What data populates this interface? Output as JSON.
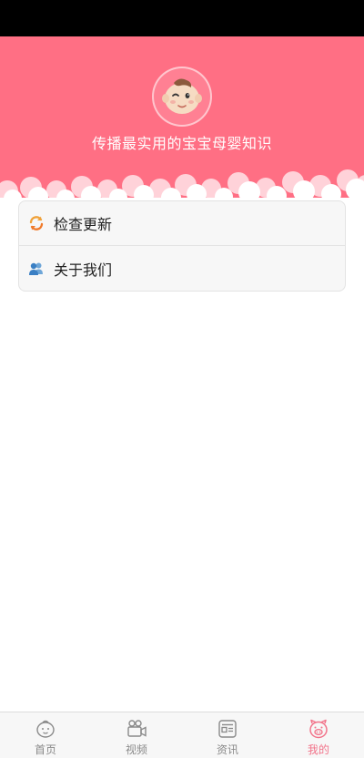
{
  "header": {
    "slogan": "传播最实用的宝宝母婴知识",
    "avatar_icon": "baby-face-icon",
    "bg_color": "#ff6f84"
  },
  "menu": {
    "items": [
      {
        "label": "检查更新",
        "icon": "refresh-icon"
      },
      {
        "label": "关于我们",
        "icon": "users-icon"
      }
    ]
  },
  "tabbar": {
    "tabs": [
      {
        "label": "首页",
        "icon": "baby-face-icon",
        "active": false
      },
      {
        "label": "视频",
        "icon": "video-camera-icon",
        "active": false
      },
      {
        "label": "资讯",
        "icon": "news-icon",
        "active": false
      },
      {
        "label": "我的",
        "icon": "pig-icon",
        "active": true
      }
    ],
    "active_color": "#f2738a"
  }
}
